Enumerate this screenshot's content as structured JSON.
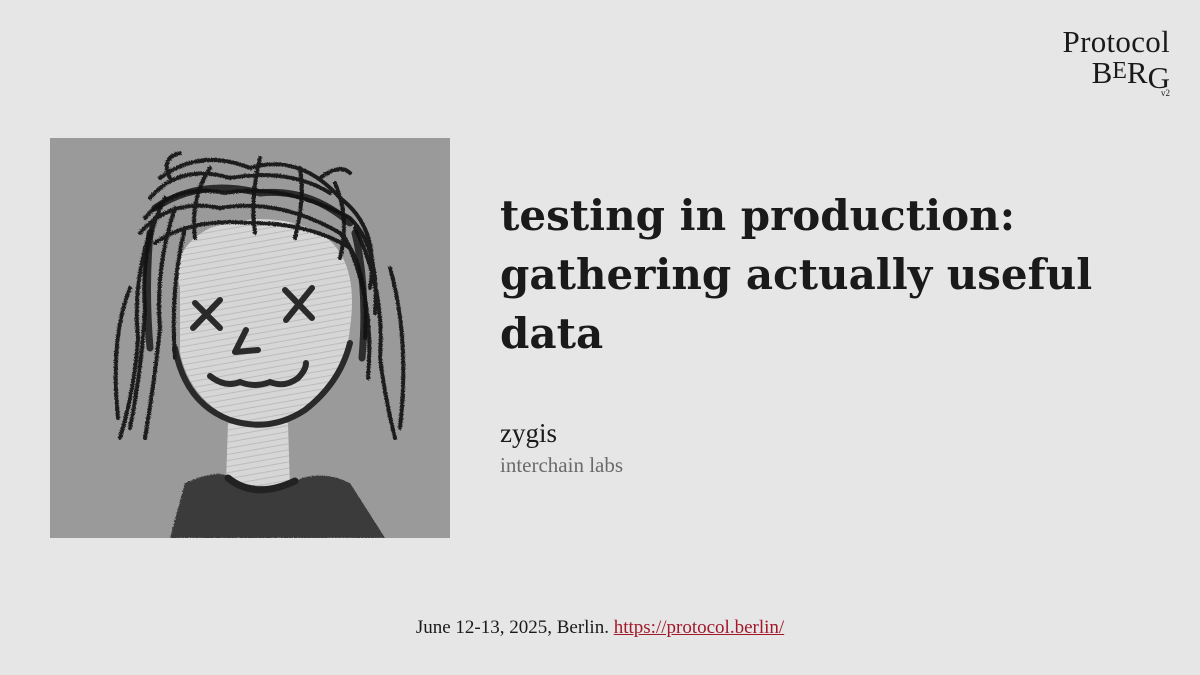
{
  "logo": {
    "line1": "Protocol",
    "berg_b": "B",
    "berg_e": "E",
    "berg_r": "R",
    "berg_g": "G",
    "version": "v2"
  },
  "avatar": {
    "icon": "crayon-drawn-face-with-x-eyes"
  },
  "title": {
    "line1": "testing in production:",
    "line2": "gathering actually useful",
    "line3": "data"
  },
  "speaker": {
    "name": "zygis",
    "affiliation": "interchain labs"
  },
  "footer": {
    "date_location": "June 12-13, 2025, Berlin.",
    "link_text": "https://protocol.berlin/",
    "link_color": "#a0182a"
  }
}
